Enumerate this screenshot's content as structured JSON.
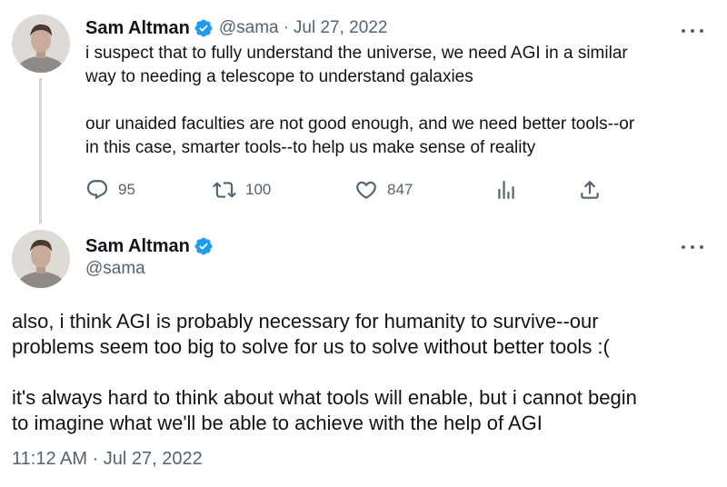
{
  "colors": {
    "text_primary": "#0f1419",
    "text_secondary": "#536471",
    "verified_badge": "#1d9bf0",
    "thread_line": "#cfd9de"
  },
  "parent_tweet": {
    "author_name": "Sam Altman",
    "handle": "@sama",
    "separator": "·",
    "date": "Jul 27, 2022",
    "paragraphs": [
      "i suspect that to fully understand the universe, we need AGI in a similar\nway to needing a telescope to understand galaxies",
      "our unaided faculties are not good enough, and we need better tools--or\nin this case, smarter tools--to help us make sense of reality"
    ],
    "actions": {
      "reply_icon": "reply-icon",
      "replies": "95",
      "retweet_icon": "retweet-icon",
      "retweets": "100",
      "like_icon": "heart-icon",
      "likes": "847",
      "views_icon": "analytics-icon",
      "share_icon": "share-icon"
    }
  },
  "main_tweet": {
    "author_name": "Sam Altman",
    "handle": "@sama",
    "paragraphs": [
      "also, i think AGI is probably necessary for humanity to survive--our\nproblems seem too big to solve for us to solve without better tools :(",
      "it's always hard to think about what tools will enable, but i cannot begin\nto imagine what we'll be able to achieve with the help of AGI"
    ],
    "timestamp": "11:12 AM · Jul 27, 2022"
  }
}
